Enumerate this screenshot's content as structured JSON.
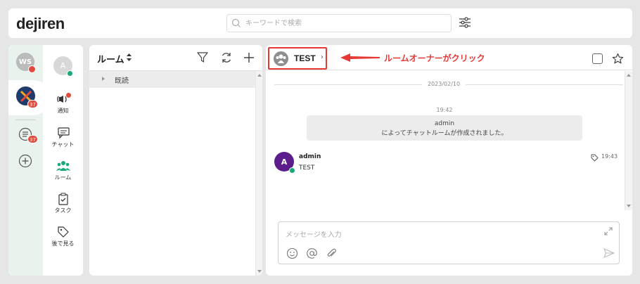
{
  "header": {
    "logo": "dejiren",
    "search_placeholder": "キーワードで検索"
  },
  "rail": {
    "workspace_initials": "WS",
    "active_workspace_badge": "37",
    "list_badge": "37",
    "user_initial": "A",
    "nav": [
      {
        "label": "通知",
        "icon": "broadcast-icon"
      },
      {
        "label": "チャット",
        "icon": "chat-icon"
      },
      {
        "label": "ルーム",
        "icon": "room-icon"
      },
      {
        "label": "タスク",
        "icon": "task-icon"
      },
      {
        "label": "後で見る",
        "icon": "tag-icon"
      }
    ]
  },
  "roomlist": {
    "title": "ルーム",
    "groups": [
      {
        "name": "既読"
      }
    ]
  },
  "chat": {
    "room_name": "TEST",
    "annotation": "ルームオーナーがクリック",
    "date": "2023/02/10",
    "system_message": {
      "time": "19:42",
      "line1": "admin",
      "line2": "によってチャットルームが作成されました。"
    },
    "messages": [
      {
        "avatar_initial": "A",
        "author": "admin",
        "text": "TEST",
        "time": "19:43"
      }
    ],
    "composer_placeholder": "メッセージを入力"
  },
  "colors": {
    "accent_green": "#19a974",
    "badge_red": "#e24a3b",
    "annotation_red": "#e53935",
    "message_avatar": "#5b1c8c"
  }
}
